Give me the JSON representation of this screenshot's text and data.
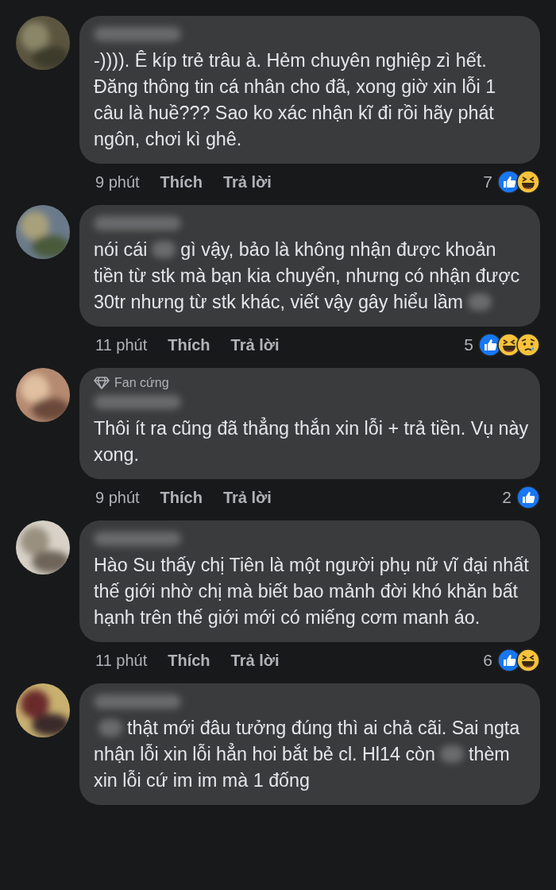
{
  "comments": [
    {
      "parts": [
        {
          "kind": "text",
          "text": "-)))). Ê kíp trẻ trâu à. Hẻm chuyên nghiệp zì hết. Đăng thông tin cá nhân cho đã, xong giờ xin lỗi 1 câu là huề??? Sao ko xác nhận kĩ đi rồi hãy phát ngôn, chơi kì ghê."
        }
      ],
      "time": "9 phút",
      "like": "Thích",
      "reply": "Trả lời",
      "count": "7",
      "reactions": [
        {
          "kind": "like"
        },
        {
          "kind": "haha"
        }
      ]
    },
    {
      "parts": [
        {
          "kind": "text",
          "text": "nói cái"
        },
        {
          "kind": "blur"
        },
        {
          "kind": "text",
          "text": "gì vậy, bảo là không nhận được khoản tiền từ stk mà bạn kia chuyển, nhưng có nhận được 30tr nhưng từ stk khác, viết vậy gây hiểu lầm"
        },
        {
          "kind": "blur"
        }
      ],
      "time": "11 phút",
      "like": "Thích",
      "reply": "Trả lời",
      "count": "5",
      "reactions": [
        {
          "kind": "like"
        },
        {
          "kind": "haha"
        },
        {
          "kind": "sad"
        }
      ]
    },
    {
      "badge": "Fan cứng",
      "parts": [
        {
          "kind": "text",
          "text": "Thôi ít ra cũng đã thẳng thắn xin lỗi + trả tiền. Vụ này xong."
        }
      ],
      "time": "9 phút",
      "like": "Thích",
      "reply": "Trả lời",
      "count": "2",
      "reactions": [
        {
          "kind": "like"
        }
      ]
    },
    {
      "parts": [
        {
          "kind": "text",
          "text": "Hào Su thấy chị Tiên là một người phụ nữ vĩ đại nhất thế giới nhờ chị mà biết bao mảnh đời khó khăn bất hạnh trên thế giới mới có miếng cơm manh áo."
        }
      ],
      "time": "11 phút",
      "like": "Thích",
      "reply": "Trả lời",
      "count": "6",
      "reactions": [
        {
          "kind": "like"
        },
        {
          "kind": "haha"
        }
      ]
    },
    {
      "parts": [
        {
          "kind": "blur"
        },
        {
          "kind": "text",
          "text": "thật mới đâu tưởng đúng thì ai chả cãi. Sai ngta nhận lỗi xin lỗi hẳn hoi bắt bẻ cl. Hl14 còn"
        },
        {
          "kind": "blur"
        },
        {
          "kind": "text",
          "text": "thèm xin lỗi cứ im im mà 1 đống"
        }
      ]
    }
  ]
}
